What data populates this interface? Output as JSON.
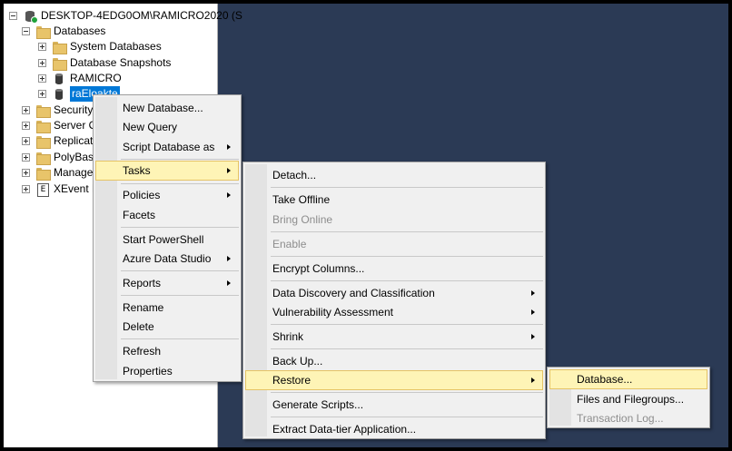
{
  "tree": {
    "server": "DESKTOP-4EDG0OM\\RAMICRO2020 (S",
    "databases": "Databases",
    "system_databases": "System Databases",
    "database_snapshots": "Database Snapshots",
    "db1": "RAMICRO",
    "db2": "raEloakte",
    "security": "Security",
    "server_objects": "Server O",
    "replication": "Replicati",
    "polybase": "PolyBase",
    "management": "Manage",
    "xevent": "XEvent P"
  },
  "context_menu": {
    "new_database": "New Database...",
    "new_query": "New Query",
    "script_database_as": "Script Database as",
    "tasks": "Tasks",
    "policies": "Policies",
    "facets": "Facets",
    "start_powershell": "Start PowerShell",
    "azure_data_studio": "Azure Data Studio",
    "reports": "Reports",
    "rename": "Rename",
    "delete": "Delete",
    "refresh": "Refresh",
    "properties": "Properties"
  },
  "tasks_menu": {
    "detach": "Detach...",
    "take_offline": "Take Offline",
    "bring_online": "Bring Online",
    "enable": "Enable",
    "encrypt_columns": "Encrypt Columns...",
    "data_discovery": "Data Discovery and Classification",
    "vulnerability": "Vulnerability Assessment",
    "shrink": "Shrink",
    "back_up": "Back Up...",
    "restore": "Restore",
    "generate_scripts": "Generate Scripts...",
    "extract": "Extract Data-tier Application..."
  },
  "restore_menu": {
    "database": "Database...",
    "files_filegroups": "Files and Filegroups...",
    "transaction_log": "Transaction Log..."
  },
  "colors": {
    "workspace": "#2b3a55",
    "highlight": "#fef4b6",
    "selection": "#0078d7"
  }
}
